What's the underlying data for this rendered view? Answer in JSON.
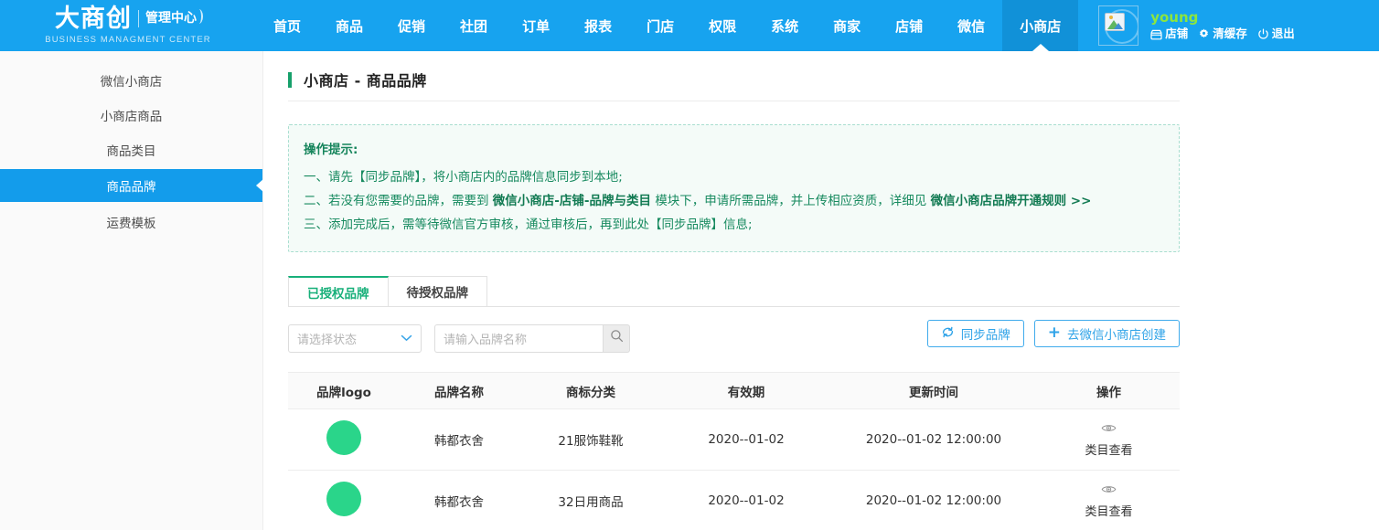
{
  "header": {
    "logo_cn": "大商创",
    "logo_badge": "管理中心",
    "logo_en": "BUSINESS MANAGMENT CENTER",
    "nav": [
      {
        "label": "首页",
        "active": false
      },
      {
        "label": "商品",
        "active": false
      },
      {
        "label": "促销",
        "active": false
      },
      {
        "label": "社团",
        "active": false
      },
      {
        "label": "订单",
        "active": false
      },
      {
        "label": "报表",
        "active": false
      },
      {
        "label": "门店",
        "active": false
      },
      {
        "label": "权限",
        "active": false
      },
      {
        "label": "系统",
        "active": false
      },
      {
        "label": "商家",
        "active": false
      },
      {
        "label": "店铺",
        "active": false
      },
      {
        "label": "微信",
        "active": false
      },
      {
        "label": "小商店",
        "active": true
      }
    ],
    "user": {
      "name": "young",
      "avatar_icon": "broken-image-icon",
      "links": [
        {
          "label": "店铺",
          "icon": "shop-icon"
        },
        {
          "label": "清缓存",
          "icon": "gear-icon"
        },
        {
          "label": "退出",
          "icon": "power-icon"
        }
      ]
    }
  },
  "sidebar": {
    "items": [
      {
        "label": "微信小商店",
        "active": false
      },
      {
        "label": "小商店商品",
        "active": false
      },
      {
        "label": "商品类目",
        "active": false
      },
      {
        "label": "商品品牌",
        "active": true
      },
      {
        "label": "运费模板",
        "active": false
      }
    ]
  },
  "main": {
    "title": "小商店 -  商品品牌",
    "tips": {
      "title": "操作提示:",
      "line1_a": "一、请先【同步品牌】，将小商店内的品牌信息同步到本地;",
      "line2_a": "二、若没有您需要的品牌，需要到",
      "line2_b": "微信小商店-店铺-品牌与类目",
      "line2_c": "模块下，申请所需品牌，并上传相应资质，详细见",
      "line2_link": "微信小商店品牌开通规则 >>",
      "line3_a": "三、添加完成后，需等待微信官方审核，通过审核后，再到此处【同步品牌】信息;"
    },
    "tabs": [
      {
        "label": "已授权品牌",
        "active": true
      },
      {
        "label": "待授权品牌",
        "active": false
      }
    ],
    "filters": {
      "status_placeholder": "请选择状态",
      "status_icon": "chevron-down-icon",
      "search_placeholder": "请输入品牌名称",
      "search_value": "",
      "search_icon": "search-icon"
    },
    "actions": [
      {
        "label": "同步品牌",
        "icon": "refresh-icon"
      },
      {
        "label": "去微信小商店创建",
        "icon": "plus-icon"
      }
    ],
    "table": {
      "columns": [
        "品牌logo",
        "品牌名称",
        "商标分类",
        "有效期",
        "更新时间",
        "操作"
      ],
      "rows": [
        {
          "logo_color": "#2ad58a",
          "name": "韩都衣舍",
          "category": "21服饰鞋靴",
          "valid_until": "2020--01-02",
          "updated_at": "2020--01-02 12:00:00",
          "action_label": "类目查看",
          "action_icon": "eye-icon"
        },
        {
          "logo_color": "#2ad58a",
          "name": "韩都衣舍",
          "category": "32日用商品",
          "valid_until": "2020--01-02",
          "updated_at": "2020--01-02 12:00:00",
          "action_label": "类目查看",
          "action_icon": "eye-icon"
        }
      ]
    }
  },
  "colors": {
    "header_blue": "#17a3ef",
    "header_blue_active": "#1191d8",
    "sidebar_active": "#139ceb",
    "accent_green": "#17a06b",
    "tab_active_green": "#18b07a",
    "tips_green": "#178a5f",
    "button_blue": "#2fa3e8",
    "username_green": "#8ce63f",
    "logo_green": "#2ad58a"
  }
}
